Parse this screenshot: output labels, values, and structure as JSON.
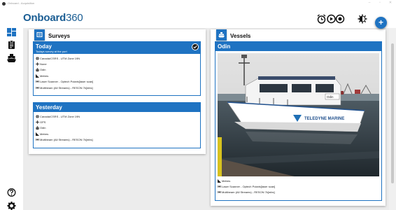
{
  "window": {
    "title": "Onboard - Acquisition"
  },
  "app": {
    "brand_bold": "Onboard",
    "brand_light": "360"
  },
  "surveys": {
    "title": "Surveys",
    "today": {
      "title": "Today",
      "subtitle": "Todays survey at the port",
      "items": [
        {
          "icon": "globe-icon",
          "text": "Canada/CSRS - UTM Zone 19N"
        },
        {
          "icon": "positioning-icon",
          "text": "None"
        },
        {
          "icon": "vessel-icon",
          "text": "Odin"
        },
        {
          "icon": "units-icon",
          "text": "Metres"
        },
        {
          "icon": "laser-icon",
          "text": "Laser Scanner - Optech Polaris[laser scan]"
        },
        {
          "icon": "sonar-icon",
          "text": "Multibeam (All Streams) - RESON 7k[mbs]"
        }
      ]
    },
    "yesterday": {
      "title": "Yesterday",
      "items": [
        {
          "icon": "globe-icon",
          "text": "Canada/CSRS - UTM Zone 19N"
        },
        {
          "icon": "positioning-icon",
          "text": "GPS"
        },
        {
          "icon": "vessel-icon",
          "text": "Odin"
        },
        {
          "icon": "units-icon",
          "text": "Metres"
        },
        {
          "icon": "sonar-icon",
          "text": "Multibeam (All Streams) - RESON 7k[mbs]"
        }
      ]
    }
  },
  "vessels": {
    "title": "Vessels",
    "odin": {
      "title": "Odin",
      "items": [
        {
          "icon": "units-icon",
          "text": "Metres"
        },
        {
          "icon": "laser-icon",
          "text": "Laser Scanner - Optech Polaris[laser scan]"
        },
        {
          "icon": "sonar-icon",
          "text": "Multibeam (All Streams) - RESON 7k[mbs]"
        }
      ],
      "boat_name": "Odin",
      "boat_brand": "TELEDYNE MARINE"
    }
  },
  "colors": {
    "accent": "#1f73c2",
    "brand": "#1a5d93",
    "content_bg": "#ececec"
  }
}
